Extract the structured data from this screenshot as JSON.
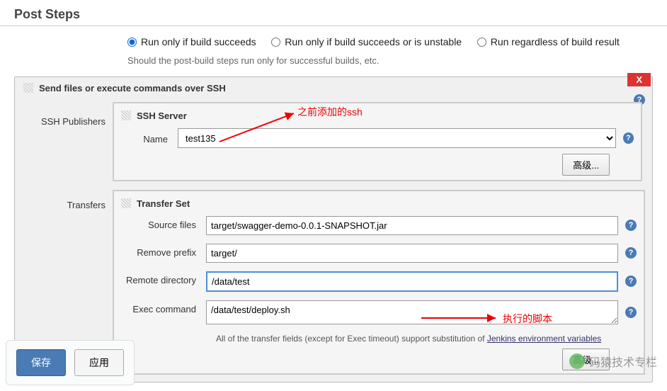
{
  "section_title": "Post Steps",
  "radios": {
    "opt1": "Run only if build succeeds",
    "opt2": "Run only if build succeeds or is unstable",
    "opt3": "Run regardless of build result"
  },
  "radio_desc": "Should the post-build steps run only for successful builds, etc.",
  "panel": {
    "title": "Send files or execute commands over SSH",
    "close": "X",
    "side_label": "SSH Publishers",
    "ssh_server_title": "SSH Server",
    "name_label": "Name",
    "name_value": "test135",
    "adv_btn": "高级...",
    "transfers_label": "Transfers",
    "transfer_set_title": "Transfer Set",
    "source_label": "Source files",
    "source_value": "target/swagger-demo-0.0.1-SNAPSHOT.jar",
    "remove_label": "Remove prefix",
    "remove_value": "target/",
    "remote_label": "Remote directory",
    "remote_value": "/data/test",
    "exec_label": "Exec command",
    "exec_value": "/data/test/deploy.sh",
    "hint_pre": "All of the transfer fields (except for Exec timeout) support substitution of ",
    "hint_link": "Jenkins environment variables"
  },
  "annotations": {
    "ssh_note": "之前添加的ssh",
    "exec_note": "执行的脚本"
  },
  "buttons": {
    "save": "保存",
    "apply": "应用"
  },
  "watermark": "码猿技术专栏"
}
